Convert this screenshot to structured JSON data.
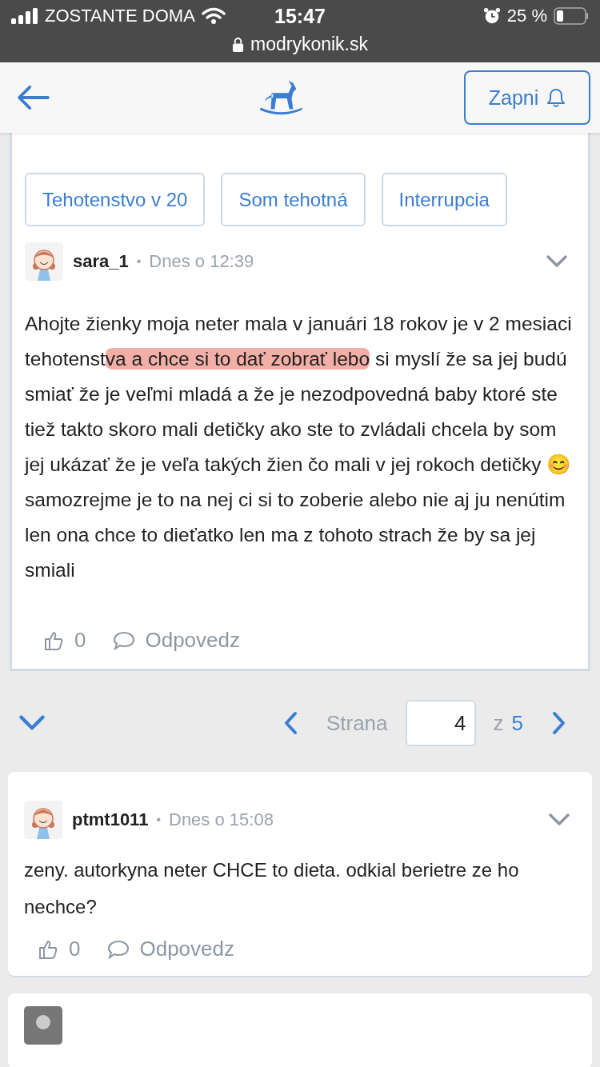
{
  "status_bar": {
    "carrier": "ZOSTANTE DOMA",
    "time": "15:47",
    "battery": "25 %",
    "url": "modrykonik.sk"
  },
  "header": {
    "notify_button": "Zapni"
  },
  "post": {
    "tags": [
      "Tehotenstvo v 20",
      "Som tehotná",
      "Interrupcia"
    ],
    "author": "sara_1",
    "separator": "•",
    "time": "Dnes o 12:39",
    "body": [
      {
        "text": "Ahojte žienky moja neter mala v januári 18 rokov je v 2 mesiaci tehotenst",
        "highlighted": false
      },
      {
        "text": "va a chce si to dať zobrať lebo",
        "highlighted": true
      },
      {
        "text": " si myslí že sa jej budú smiať že je veľmi mladá a že je nezodpovedná baby ktoré ste tiež takto skoro mali detičky ako ste to zvládali chcela by som jej ukázať že je veľa takých žien čo mali v jej rokoch detičky 😊 samozrejme je to na nej ci si to zoberie alebo nie aj ju nenútim len ona chce to dieťatko len ma z tohoto strach že by sa jej smiali",
        "highlighted": false
      }
    ],
    "likes": "0",
    "reply": "Odpovedz"
  },
  "pagination": {
    "label": "Strana",
    "page": "4",
    "of": "z",
    "total": "5"
  },
  "comments": [
    {
      "author": "ptmt1011",
      "separator": "•",
      "time": "Dnes o 15:08",
      "text": "zeny. autorkyna neter CHCE to dieta. odkial berietre ze ho nechce?",
      "likes": "0",
      "reply": "Odpovedz"
    }
  ]
}
